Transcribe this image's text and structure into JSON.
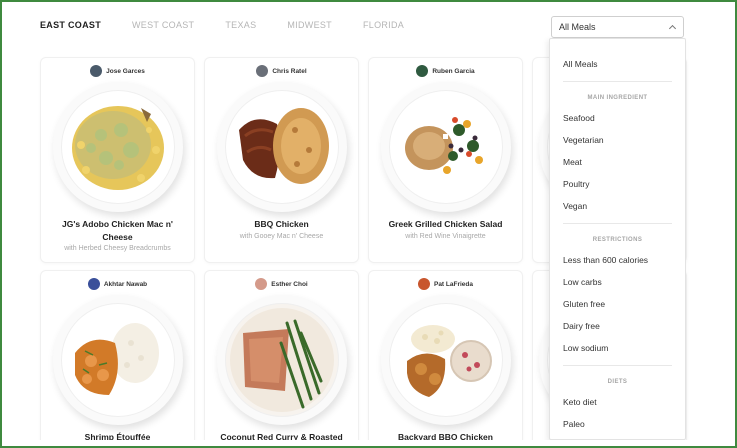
{
  "regions": {
    "tabs": [
      "EAST COAST",
      "WEST COAST",
      "TEXAS",
      "MIDWEST",
      "FLORIDA"
    ],
    "active": "EAST COAST"
  },
  "filter": {
    "selected": "All Meals",
    "options": {
      "all": "All Meals",
      "main_ingredient_heading": "MAIN INGREDIENT",
      "main_ingredient": [
        "Seafood",
        "Vegetarian",
        "Meat",
        "Poultry",
        "Vegan"
      ],
      "restrictions_heading": "RESTRICTIONS",
      "restrictions": [
        "Less than 600 calories",
        "Low carbs",
        "Gluten free",
        "Dairy free",
        "Low sodium"
      ],
      "diets_heading": "DIETS",
      "diets": [
        "Keto diet",
        "Paleo"
      ]
    }
  },
  "meals": [
    {
      "chef": "Jose Garces",
      "title_line1": "JG's Adobo Chicken Mac n'",
      "title_line2": "Cheese",
      "subtitle": "with Herbed Cheesy Breadcrumbs",
      "avatar_color": "#4a5a6a"
    },
    {
      "chef": "Chris Ratel",
      "title_line1": "BBQ Chicken",
      "title_line2": "",
      "subtitle": "with Gooey Mac n' Cheese",
      "avatar_color": "#6a6f78"
    },
    {
      "chef": "Ruben Garcia",
      "title_line1": "Greek Grilled Chicken Salad",
      "title_line2": "",
      "subtitle": "with Red Wine Vinaigrette",
      "avatar_color": "#2f5a40"
    },
    {
      "chef": "Akhtar Nawab",
      "title_line1": "Shrimp Étouffée",
      "title_line2": "",
      "subtitle": "",
      "avatar_color": "#3a4f9a"
    },
    {
      "chef": "Esther Choi",
      "title_line1": "Coconut Red Curry & Roasted",
      "title_line2": "",
      "subtitle": "",
      "avatar_color": "#d49a8a"
    },
    {
      "chef": "Pat LaFrieda",
      "title_line1": "Backyard BBQ Chicken",
      "title_line2": "",
      "subtitle": "",
      "avatar_color": "#c8562e"
    }
  ]
}
